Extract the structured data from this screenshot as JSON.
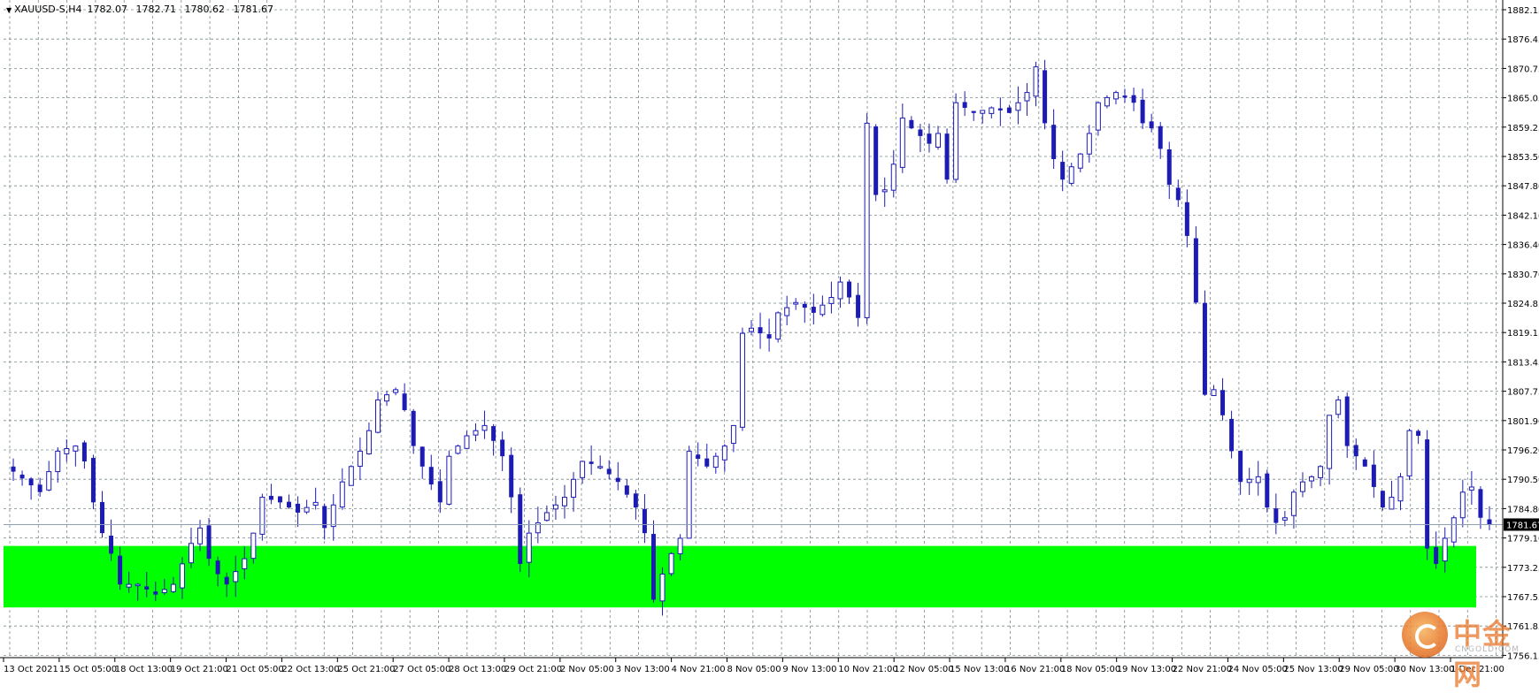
{
  "header": {
    "symbol": "XAUUSD-S,H4",
    "open": "1782.07",
    "high": "1782.71",
    "low": "1780.62",
    "close": "1781.67"
  },
  "price_label": "1781.67",
  "watermark": {
    "text": "中金网",
    "sub": "CNGOLD.COM"
  },
  "colors": {
    "candle": "#1c1cb4",
    "zone": "#00ff00",
    "grid": "#7a8a8a",
    "axis": "#000000",
    "price_line": "#8aa0b4"
  },
  "chart_data": {
    "type": "candlestick",
    "title": "XAUUSD-S,H4",
    "ylim": [
      1759.0,
      1885.0
    ],
    "grid": true,
    "y_ticks": [
      "1882.15",
      "1876.45",
      "1870.75",
      "1865.05",
      "1859.25",
      "1853.50",
      "1847.80",
      "1842.10",
      "1836.40",
      "1830.70",
      "1824.85",
      "1819.15",
      "1813.45",
      "1807.75",
      "1801.90",
      "1796.20",
      "1790.50",
      "1784.80",
      "1779.10",
      "1773.25",
      "1767.55",
      "1761.85",
      "1756.15"
    ],
    "x_ticks": [
      "13 Oct 2021",
      "15 Oct 05:00",
      "18 Oct 13:00",
      "19 Oct 21:00",
      "21 Oct 05:00",
      "22 Oct 13:00",
      "25 Oct 21:00",
      "27 Oct 05:00",
      "28 Oct 13:00",
      "29 Oct 21:00",
      "2 Nov 05:00",
      "3 Nov 13:00",
      "4 Nov 21:00",
      "8 Nov 05:00",
      "9 Nov 13:00",
      "10 Nov 21:00",
      "12 Nov 05:00",
      "15 Nov 13:00",
      "16 Nov 21:00",
      "18 Nov 05:00",
      "19 Nov 13:00",
      "22 Nov 21:00",
      "24 Nov 05:00",
      "25 Nov 13:00",
      "29 Nov 05:00",
      "30 Nov 13:00",
      "1 Dec 21:00"
    ],
    "support_zone": [
      1765.5,
      1777.5
    ],
    "last_price": 1781.67,
    "close_path": [
      [
        0,
        1792
      ],
      [
        3,
        1788
      ],
      [
        5,
        1796
      ],
      [
        7,
        1797
      ],
      [
        8,
        1794
      ],
      [
        9,
        1786
      ],
      [
        10,
        1780
      ],
      [
        11,
        1776
      ],
      [
        12,
        1770
      ],
      [
        14,
        1770
      ],
      [
        15,
        1769
      ],
      [
        16,
        1768
      ],
      [
        18,
        1770
      ],
      [
        19,
        1774
      ],
      [
        20,
        1778
      ],
      [
        21,
        1781
      ],
      [
        22,
        1775
      ],
      [
        23,
        1772
      ],
      [
        24,
        1770
      ],
      [
        26,
        1775
      ],
      [
        27,
        1780
      ],
      [
        28,
        1787
      ],
      [
        30,
        1786
      ],
      [
        32,
        1784
      ],
      [
        34,
        1786
      ],
      [
        35,
        1781
      ],
      [
        37,
        1790
      ],
      [
        39,
        1796
      ],
      [
        40,
        1800
      ],
      [
        41,
        1806
      ],
      [
        43,
        1808
      ],
      [
        44,
        1804
      ],
      [
        45,
        1797
      ],
      [
        46,
        1793
      ],
      [
        48,
        1786
      ],
      [
        49,
        1795
      ],
      [
        51,
        1799
      ],
      [
        53,
        1801
      ],
      [
        54,
        1798
      ],
      [
        55,
        1795
      ],
      [
        56,
        1787
      ],
      [
        57,
        1774
      ],
      [
        58,
        1780
      ],
      [
        60,
        1784
      ],
      [
        62,
        1787
      ],
      [
        64,
        1794
      ],
      [
        66,
        1793
      ],
      [
        68,
        1790
      ],
      [
        70,
        1785
      ],
      [
        71,
        1780
      ],
      [
        72,
        1767
      ],
      [
        73,
        1772
      ],
      [
        74,
        1776
      ],
      [
        75,
        1779
      ],
      [
        76,
        1796
      ],
      [
        78,
        1793
      ],
      [
        80,
        1797
      ],
      [
        81,
        1801
      ],
      [
        82,
        1819
      ],
      [
        83,
        1820
      ],
      [
        85,
        1818
      ],
      [
        86,
        1823
      ],
      [
        88,
        1825
      ],
      [
        90,
        1823
      ],
      [
        92,
        1826
      ],
      [
        93,
        1829
      ],
      [
        94,
        1826
      ],
      [
        95,
        1822
      ],
      [
        96,
        1860
      ],
      [
        97,
        1846
      ],
      [
        98,
        1847
      ],
      [
        99,
        1852
      ],
      [
        100,
        1861
      ],
      [
        101,
        1859
      ],
      [
        103,
        1856
      ],
      [
        104,
        1858
      ],
      [
        105,
        1849
      ],
      [
        106,
        1864
      ],
      [
        108,
        1862
      ],
      [
        110,
        1863
      ],
      [
        112,
        1862
      ],
      [
        114,
        1866
      ],
      [
        115,
        1871
      ],
      [
        116,
        1860
      ],
      [
        117,
        1853
      ],
      [
        118,
        1849
      ],
      [
        120,
        1854
      ],
      [
        121,
        1858
      ],
      [
        122,
        1864
      ],
      [
        124,
        1866
      ],
      [
        126,
        1864
      ],
      [
        127,
        1860
      ],
      [
        128,
        1859
      ],
      [
        129,
        1855
      ],
      [
        130,
        1848
      ],
      [
        131,
        1845
      ],
      [
        132,
        1838
      ],
      [
        133,
        1825
      ],
      [
        134,
        1807
      ],
      [
        135,
        1808
      ],
      [
        136,
        1803
      ],
      [
        137,
        1796
      ],
      [
        138,
        1790
      ],
      [
        140,
        1791
      ],
      [
        141,
        1785
      ],
      [
        142,
        1782
      ],
      [
        143,
        1783
      ],
      [
        144,
        1788
      ],
      [
        145,
        1790
      ],
      [
        146,
        1791
      ],
      [
        147,
        1793
      ],
      [
        148,
        1803
      ],
      [
        149,
        1806
      ],
      [
        150,
        1797
      ],
      [
        152,
        1793
      ],
      [
        153,
        1789
      ],
      [
        154,
        1785
      ],
      [
        155,
        1787
      ],
      [
        156,
        1791
      ],
      [
        157,
        1800
      ],
      [
        158,
        1799
      ],
      [
        159,
        1777
      ],
      [
        160,
        1774
      ],
      [
        161,
        1779
      ],
      [
        162,
        1783
      ],
      [
        163,
        1788
      ],
      [
        164,
        1789
      ],
      [
        165,
        1783
      ],
      [
        166,
        1781.67
      ]
    ]
  }
}
